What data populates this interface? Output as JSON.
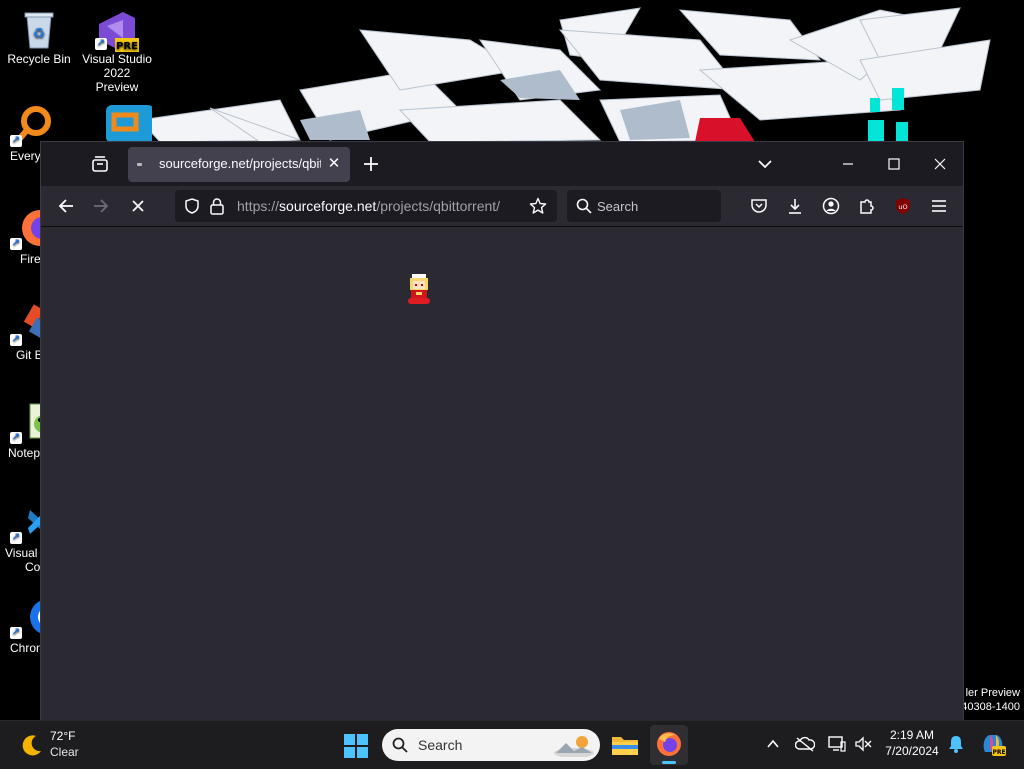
{
  "desktop": {
    "icons": [
      {
        "label": "Recycle Bin"
      },
      {
        "label": "Visual Studio 2022 Preview",
        "line1": "Visual Studio",
        "line2": "2022 Preview",
        "badge": "PRE"
      },
      {
        "label": "Every"
      },
      {
        "label": "Firef"
      },
      {
        "label": "Git B"
      },
      {
        "label": "Notep"
      },
      {
        "label": "Visual S Co",
        "line1": "Visual S",
        "line2": "Co"
      },
      {
        "label": "Chron"
      }
    ],
    "watermark": {
      "line1": "ler Preview",
      "line2": "40308-1400"
    }
  },
  "browser": {
    "tab": {
      "title": "sourceforge.net/projects/qbittorrent/"
    },
    "url": {
      "host": "sourceforge.net",
      "path": "/projects/qbittorrent/"
    },
    "search_placeholder": "Search",
    "extension_badge": "uO"
  },
  "taskbar": {
    "weather": {
      "temp": "72°F",
      "condition": "Clear"
    },
    "search_placeholder": "Search",
    "clock": {
      "time": "2:19 AM",
      "date": "7/20/2024"
    }
  },
  "colors": {
    "accent": "#0a84ff",
    "window_bg": "#2b2a33",
    "titlebar_bg": "#1c1b22"
  }
}
